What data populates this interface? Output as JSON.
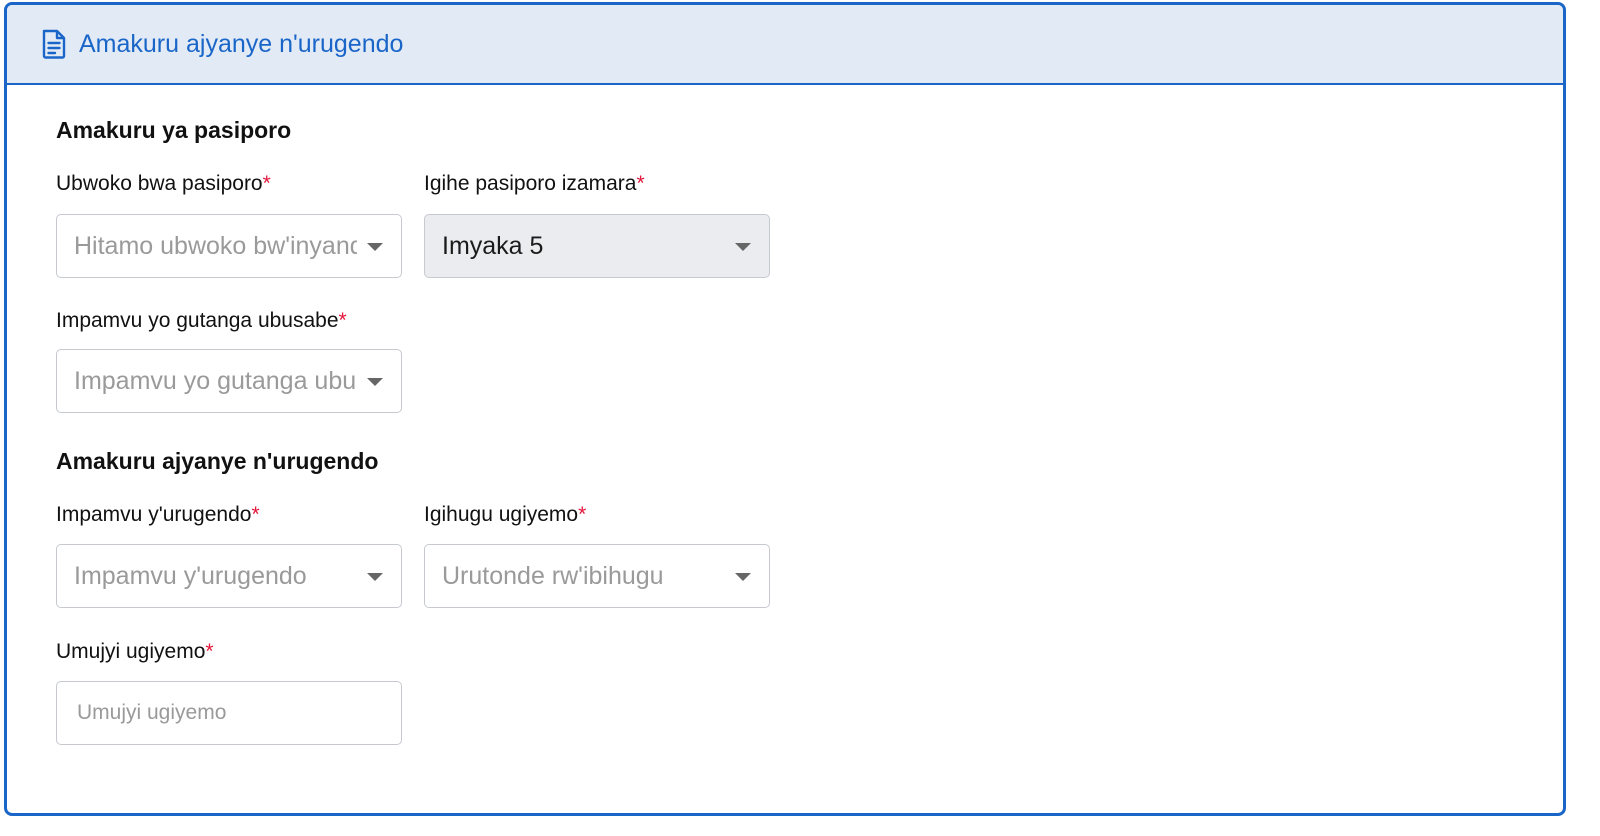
{
  "header": {
    "title": "Amakuru ajyanye n'urugendo"
  },
  "passport_section": {
    "title": "Amakuru ya pasiporo",
    "passport_type": {
      "label": "Ubwoko bwa pasiporo",
      "required_mark": "*",
      "placeholder": "Hitamo ubwoko bw'inyandiko"
    },
    "passport_validity": {
      "label": "Igihe pasiporo izamara",
      "required_mark": "*",
      "value": "Imyaka 5"
    },
    "application_reason": {
      "label": "Impamvu yo gutanga ubusabe",
      "required_mark": "*",
      "placeholder": "Impamvu yo gutanga ubusabe"
    }
  },
  "travel_section": {
    "title": "Amakuru ajyanye n'urugendo",
    "travel_reason": {
      "label": "Impamvu y'urugendo",
      "required_mark": "*",
      "placeholder": "Impamvu y'urugendo"
    },
    "destination_country": {
      "label": "Igihugu ugiyemo",
      "required_mark": "*",
      "placeholder": "Urutonde rw'ibihugu"
    },
    "destination_city": {
      "label": "Umujyi ugiyemo",
      "required_mark": "*",
      "placeholder": "Umujyi ugiyemo"
    }
  },
  "colors": {
    "accent": "#1a66c8",
    "header_bg": "#e2eaf6",
    "required": "#e4163a"
  }
}
